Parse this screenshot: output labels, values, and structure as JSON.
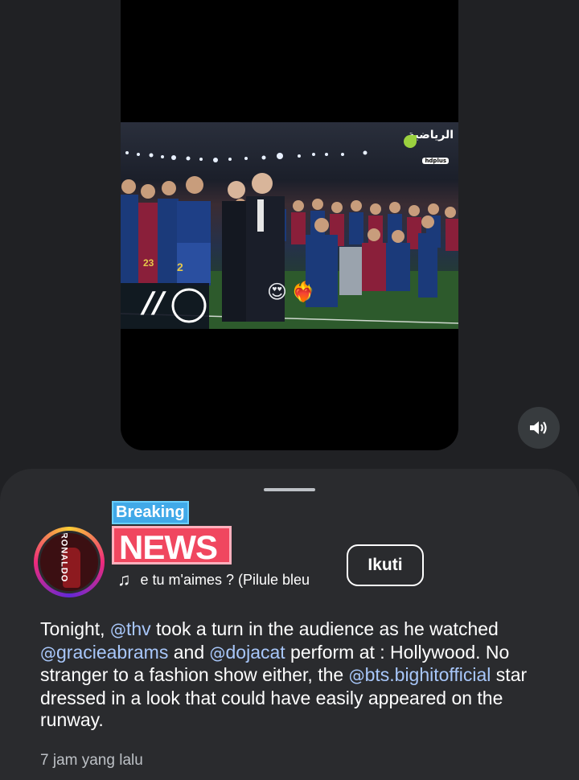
{
  "video": {
    "channel_logo_text": "الرياضية",
    "channel_logo_sub": "hdplus",
    "jersey_numbers": [
      "23",
      "2"
    ],
    "emojis": [
      "😍",
      "❤️‍🔥"
    ]
  },
  "sound_button": {
    "icon": "speaker-volume-icon"
  },
  "post": {
    "avatar_text": "RONALDO",
    "breaking_label": "Breaking",
    "news_label": "NEWS",
    "music_title": "e tu m'aimes ? (Pilule bleu",
    "follow_label": "Ikuti",
    "caption": {
      "p1": "Tonight, ",
      "m1": "thv",
      "p2": " took a turn in the audience as he watched ",
      "m2": "gracieabrams",
      "p3": " and ",
      "m3": "dojacat",
      "p4": " perform at : Hollywood. No stranger to a fashion show either, the ",
      "m4": "bts.bighitofficial",
      "p5": " star dressed in a look that could have easily appeared on the runway."
    },
    "timestamp": "7 jam yang lalu"
  },
  "colors": {
    "background": "#202124",
    "sheet": "#2a2b2e",
    "mention": "#a8c7fa",
    "breaking": "#41a9e8",
    "news": "#f0475f"
  }
}
